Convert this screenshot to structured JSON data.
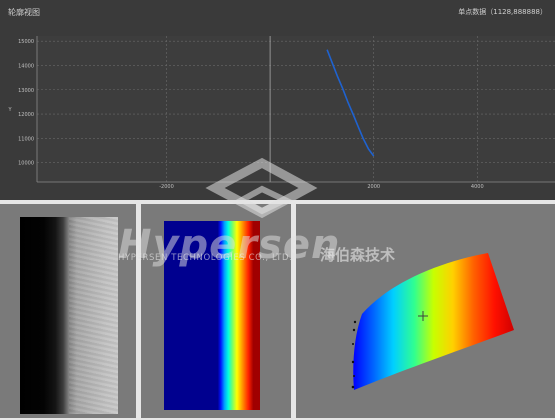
{
  "header": {
    "title": "轮廓视图",
    "point_readout": "单点数据（1128,888888）"
  },
  "chart_data": {
    "type": "line",
    "title": "",
    "xlabel": "",
    "ylabel": "Y",
    "xlim": [
      -4500,
      5500
    ],
    "ylim": [
      9200,
      15050
    ],
    "x_ticks": [
      -2000,
      2000,
      4000
    ],
    "y_ticks": [
      10000,
      11000,
      12000,
      13000,
      14000,
      15000
    ],
    "grid": true,
    "series": [
      {
        "color": "#1f62cf",
        "x": [
          1100,
          1200,
          1300,
          1400,
          1500,
          1600,
          1700,
          1800,
          1900,
          2000
        ],
        "y": [
          14650,
          14100,
          13560,
          13060,
          12500,
          12000,
          11480,
          10980,
          10560,
          10270
        ]
      }
    ]
  },
  "panels": {
    "gray": {
      "name": "grayscale-image"
    },
    "color": {
      "name": "color-height-map"
    },
    "surface": {
      "name": "3d-surface-view"
    }
  },
  "watermark": {
    "brand": "Hypersen",
    "sub": "HYPERSEN TECHNOLOGIES CO., LTD.",
    "cn": "海伯森技术"
  },
  "colors": {
    "chart_bg": "#3a3a3a",
    "panel_bg": "#7a7a7a",
    "line": "#1f62cf"
  }
}
